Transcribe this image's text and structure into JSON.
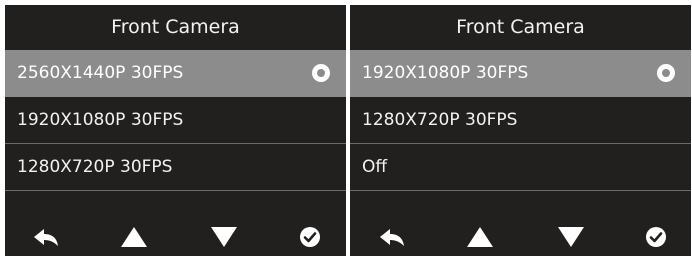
{
  "panels": [
    {
      "title": "Front Camera",
      "options": [
        {
          "label": "2560X1440P 30FPS",
          "selected": true
        },
        {
          "label": "1920X1080P 30FPS",
          "selected": false
        },
        {
          "label": "1280X720P 30FPS",
          "selected": false
        }
      ]
    },
    {
      "title": "Front Camera",
      "options": [
        {
          "label": "1920X1080P 30FPS",
          "selected": true
        },
        {
          "label": "1280X720P 30FPS",
          "selected": false
        },
        {
          "label": "Off",
          "selected": false
        }
      ]
    }
  ],
  "toolbar_icons": [
    "back-icon",
    "up-arrow-icon",
    "down-arrow-icon",
    "confirm-check-icon"
  ],
  "colors": {
    "background": "#221f1f",
    "selected_row": "#8c8c8c",
    "text": "#f2f2f2",
    "divider": "#6b6b6b"
  }
}
